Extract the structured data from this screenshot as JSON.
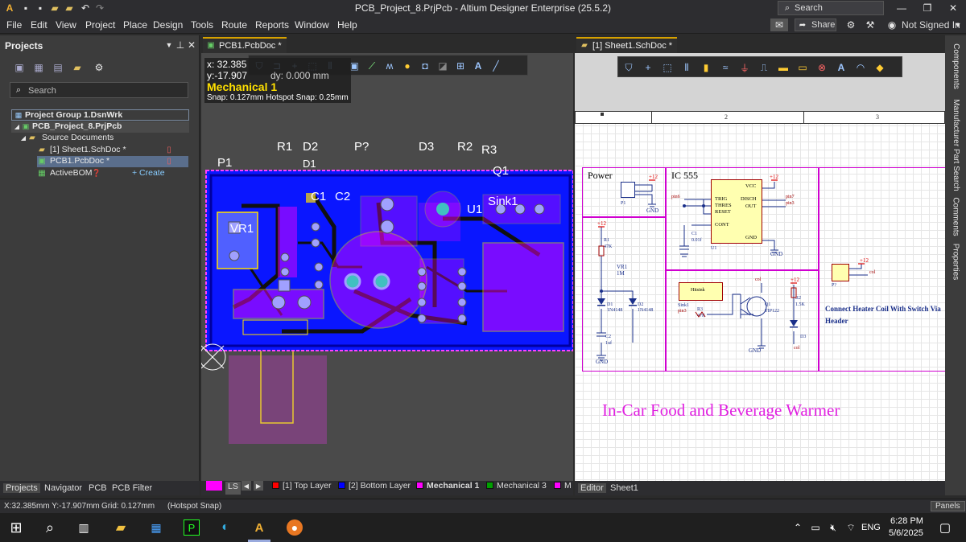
{
  "title_bar": {
    "title": "PCB_Project_8.PrjPcb - Altium Designer Enterprise (25.5.2)",
    "search_placeholder": "Search"
  },
  "menu": {
    "items": [
      "File",
      "Edit",
      "View",
      "Project",
      "Place",
      "Design",
      "Tools",
      "Route",
      "Reports",
      "Window",
      "Help"
    ],
    "share_label": "Share",
    "user_label": "Not Signed In"
  },
  "projects_panel": {
    "title": "Projects",
    "search_placeholder": "Search",
    "tree": {
      "group": "Project Group 1.DsnWrk",
      "project": "PCB_Project_8.PrjPcb",
      "folder": "Source Documents",
      "doc1": "[1] Sheet1.SchDoc *",
      "doc2": "PCB1.PcbDoc *",
      "bom": "ActiveBOM",
      "create": "+ Create"
    },
    "bottom_tabs": [
      "Projects",
      "Navigator",
      "PCB",
      "PCB Filter"
    ]
  },
  "pcb_editor": {
    "tab": "PCB1.PcbDoc *",
    "hud": {
      "x": "x: 32.385",
      "y": "y:-17.907",
      "dy": "dy:  0.000  mm",
      "layer": "Mechanical 1",
      "snap": "Snap: 0.127mm Hotspot Snap: 0.25mm"
    },
    "designators": {
      "p1": "P1",
      "r1": "R1",
      "d2": "D2",
      "d1": "D1",
      "p7": "P?",
      "d3": "D3",
      "r2": "R2",
      "r3": "R3",
      "c1": "C1",
      "c2": "C2",
      "vr1": "VR1",
      "u1": "U1",
      "q1": "Q1",
      "sink1": "Sink1"
    },
    "layers": {
      "ls": "LS",
      "top": "[1] Top Layer",
      "bottom": "[2] Bottom Layer",
      "mech1": "Mechanical 1",
      "mech3": "Mechanical 3",
      "more": "M"
    },
    "layer_colors": {
      "top": "#ff0000",
      "bottom": "#0000ff",
      "mech1": "#ff00ff",
      "mech3": "#00a000",
      "board": "#0a16ff"
    }
  },
  "schematic_editor": {
    "tab": "[1] Sheet1.SchDoc *",
    "zone_numbers": [
      "2",
      "3"
    ],
    "blocks": {
      "power": "Power",
      "ic": "IC 555"
    },
    "ic_pins": {
      "vcc": "VCC",
      "trig": "TRIG",
      "thres": "THRES",
      "reset": "RESET",
      "disch": "DISCH",
      "out": "OUT",
      "cont": "CONT",
      "gnd": "GND"
    },
    "labels": {
      "u1": "U1",
      "p1": "P1",
      "r1": "R1",
      "r1v": "47K",
      "vr1": "VR1",
      "vr1v": "1M",
      "d1": "D1",
      "d1v": "1N4148",
      "d2": "D2",
      "d2v": "1N4148",
      "c2": "C2",
      "c2v": "1uf",
      "c1": "C1",
      "c1v": "0.01f",
      "hitsink": "Hitsink",
      "sink1": "Sink1",
      "r3": "R3",
      "r3v": "47K",
      "q1": "Q1",
      "q1v": "TIP122",
      "r2": "R2",
      "r2v": "1.5K",
      "d3": "D3",
      "p7": "P?",
      "gnd": "GND",
      "v12": "+12"
    },
    "nets": {
      "pin6": "pin6",
      "pin7": "pin7",
      "pin3": "pin3",
      "col": "col"
    },
    "note": "Connect Heater Coil With Switch Via Header",
    "title": "In-Car Food and Beverage Warmer",
    "bottom_tabs": [
      "Editor",
      "Sheet1"
    ]
  },
  "right_dock": [
    "Components",
    "Manufacturer Part Search",
    "Comments",
    "Properties"
  ],
  "status": {
    "coords": "X:32.385mm Y:-17.907mm",
    "grid": "Grid: 0.127mm",
    "snap": "(Hotspot Snap)",
    "panels": "Panels"
  },
  "taskbar": {
    "lang": "ENG",
    "time": "6:28 PM",
    "date": "5/6/2025"
  }
}
